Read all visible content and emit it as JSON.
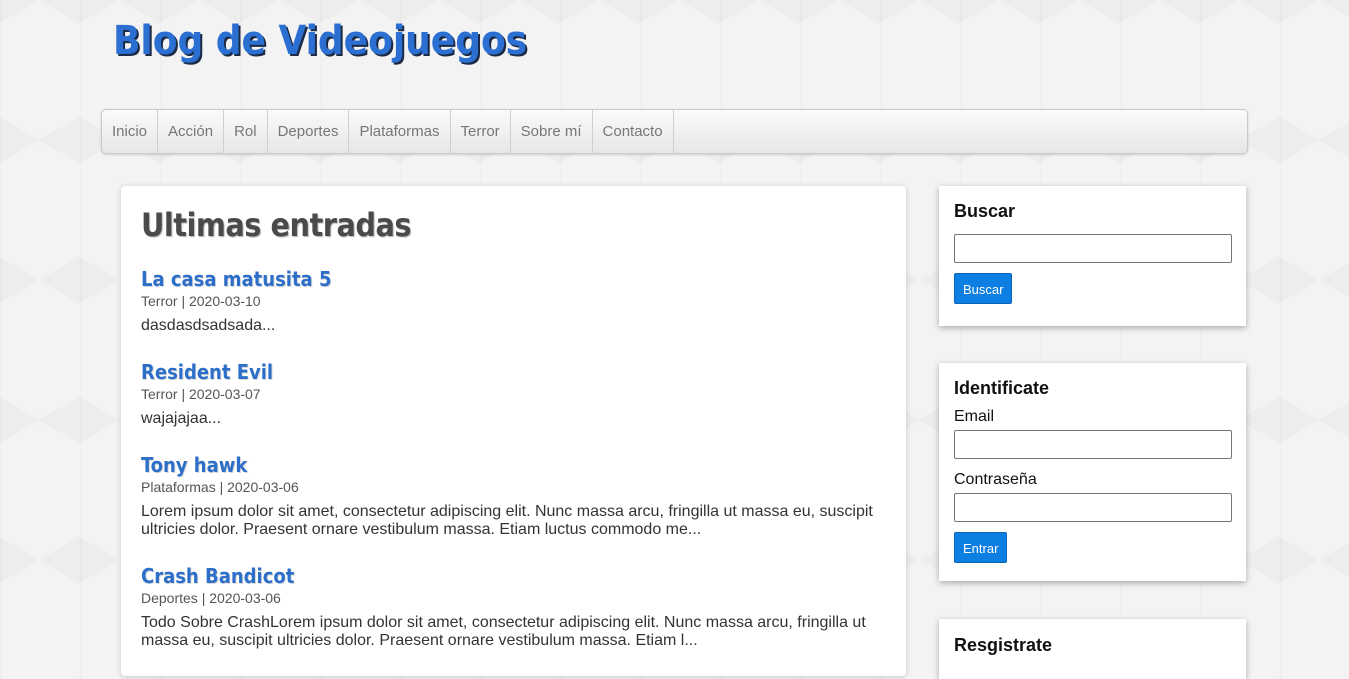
{
  "header": {
    "site_title": "Blog de Videojuegos"
  },
  "nav": {
    "items": [
      "Inicio",
      "Acción",
      "Rol",
      "Deportes",
      "Plataformas",
      "Terror",
      "Sobre mí",
      "Contacto"
    ]
  },
  "main": {
    "title": "Ultimas entradas",
    "entries": [
      {
        "title": "La casa matusita 5",
        "meta": "Terror | 2020-03-10",
        "excerpt": "dasdasdsadsada..."
      },
      {
        "title": "Resident Evil",
        "meta": "Terror | 2020-03-07",
        "excerpt": "wajajajaa..."
      },
      {
        "title": "Tony hawk",
        "meta": "Plataformas | 2020-03-06",
        "excerpt": "Lorem ipsum dolor sit amet, consectetur adipiscing elit. Nunc massa arcu, fringilla ut massa eu, suscipit ultricies dolor. Praesent ornare vestibulum massa. Etiam luctus commodo me..."
      },
      {
        "title": "Crash Bandicot",
        "meta": "Deportes | 2020-03-06",
        "excerpt": "Todo Sobre CrashLorem ipsum dolor sit amet, consectetur adipiscing elit. Nunc massa arcu, fringilla ut massa eu, suscipit ultricies dolor. Praesent ornare vestibulum massa. Etiam l..."
      }
    ]
  },
  "sidebar": {
    "search": {
      "title": "Buscar",
      "input_value": "",
      "button_label": "Buscar"
    },
    "login": {
      "title": "Identificate",
      "email_label": "Email",
      "email_value": "",
      "password_label": "Contraseña",
      "password_value": "",
      "button_label": "Entrar"
    },
    "register": {
      "title": "Resgistrate"
    }
  },
  "colors": {
    "accent": "#2a6fd1",
    "button": "#0d7fe3"
  }
}
